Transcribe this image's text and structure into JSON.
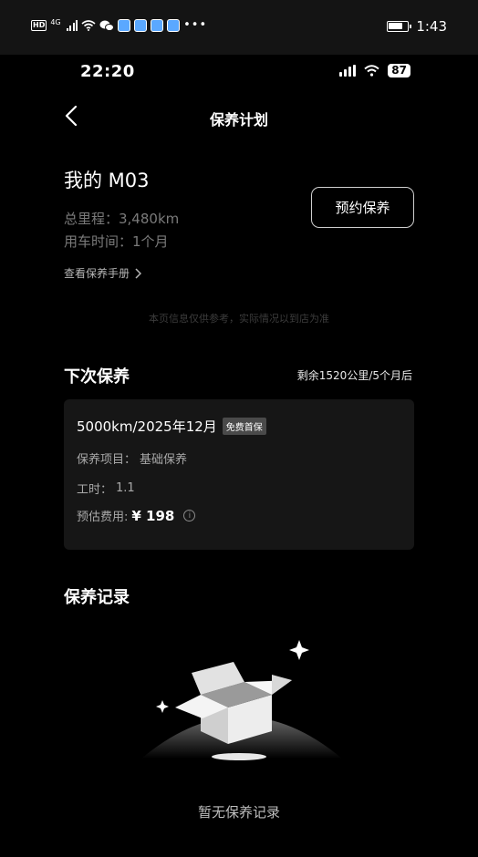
{
  "system_status": {
    "hd_label": "HD",
    "network_label": "4G",
    "time": "1:43",
    "more_icon": "more-dots"
  },
  "inner_status": {
    "time": "22:20",
    "battery": "87"
  },
  "nav": {
    "back_icon": "chevron-left",
    "title": "保养计划"
  },
  "vehicle": {
    "name": "我的 M03",
    "mileage": "总里程：3,480km",
    "usage_time": "用车时间：1个月",
    "manual_link": "查看保养手册",
    "book_button": "预约保养"
  },
  "disclaimer": "本页信息仅供参考，实际情况以到店为准",
  "next_service": {
    "title": "下次保养",
    "remaining": "剩余1520公里/5个月后",
    "card": {
      "heading": "5000km/2025年12月",
      "tag": "免费首保",
      "items_label": "保养项目：",
      "items_value": "基础保养",
      "hours_label": "工时：",
      "hours_value": "1.1",
      "cost_label": "预估费用:",
      "cost_value": "¥ 198"
    }
  },
  "records": {
    "title": "保养记录",
    "empty_text": "暂无保养记录"
  },
  "colors": {
    "background": "#000000",
    "card": "#161616",
    "muted_text": "#7a7a7a",
    "tag_bg": "#4a4a4a"
  }
}
